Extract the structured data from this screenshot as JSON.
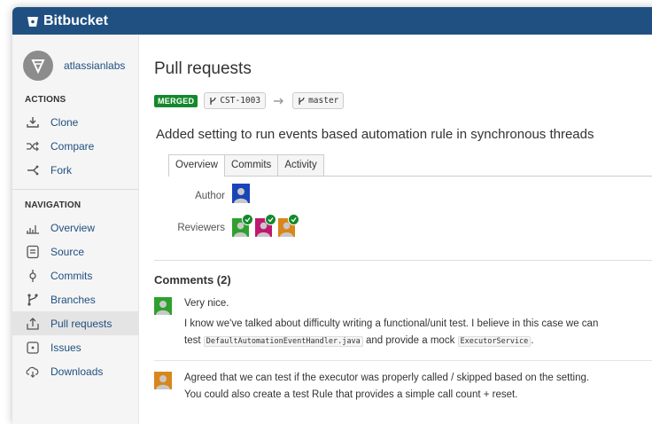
{
  "app": {
    "name": "Bitbucket"
  },
  "sidebar": {
    "user": "atlassianlabs",
    "actions_heading": "ACTIONS",
    "actions": [
      {
        "label": "Clone",
        "icon": "clone-icon"
      },
      {
        "label": "Compare",
        "icon": "compare-icon"
      },
      {
        "label": "Fork",
        "icon": "fork-icon"
      }
    ],
    "navigation_heading": "NAVIGATION",
    "navigation": [
      {
        "label": "Overview",
        "icon": "overview-icon"
      },
      {
        "label": "Source",
        "icon": "source-icon"
      },
      {
        "label": "Commits",
        "icon": "commits-icon"
      },
      {
        "label": "Branches",
        "icon": "branches-icon"
      },
      {
        "label": "Pull requests",
        "icon": "pull-requests-icon",
        "active": true
      },
      {
        "label": "Issues",
        "icon": "issues-icon"
      },
      {
        "label": "Downloads",
        "icon": "downloads-icon"
      }
    ]
  },
  "main": {
    "title": "Pull requests",
    "status": "MERGED",
    "source_branch": "CST-1003",
    "target_branch": "master",
    "pr_title": "Added setting to run events based automation rule in synchronous threads",
    "tabs": [
      "Overview",
      "Commits",
      "Activity"
    ],
    "active_tab": "Overview",
    "author_label": "Author",
    "reviewers_label": "Reviewers",
    "comments_heading": "Comments (2)",
    "comments": [
      {
        "line1": "Very nice.",
        "line2": "I know we've talked about difficulty writing a functional/unit test. I believe in this case we can",
        "line3_a": "test",
        "code1": "DefaultAutomationEventHandler.java",
        "line3_b": "and provide a mock",
        "code2": "ExecutorService",
        "line3_c": "."
      },
      {
        "line1": "Agreed that we can test if the executor was properly called / skipped based on the setting.",
        "line2": "You could also create a test Rule that provides a simple call count + reset."
      }
    ]
  },
  "colors": {
    "header": "#205081",
    "link": "#205081",
    "merged": "#14892c",
    "author_avatar": "#1a44b8",
    "reviewer1": "#2ea02e",
    "reviewer2": "#c0186f",
    "reviewer3": "#d9861a",
    "commenter1": "#2ea02e",
    "commenter2": "#d9861a"
  }
}
